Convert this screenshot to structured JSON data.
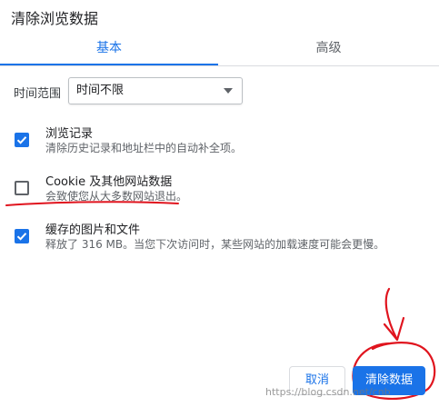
{
  "dialog": {
    "title": "清除浏览数据"
  },
  "tabs": [
    {
      "label": "基本",
      "active": true
    },
    {
      "label": "高级",
      "active": false
    }
  ],
  "time_range": {
    "label": "时间范围",
    "selected": "时间不限"
  },
  "items": [
    {
      "title": "浏览记录",
      "description": "清除历史记录和地址栏中的自动补全项。",
      "checked": true
    },
    {
      "title": "Cookie 及其他网站数据",
      "description": "会致使您从大多数网站退出。",
      "checked": false
    },
    {
      "title": "缓存的图片和文件",
      "description": "释放了 316 MB。当您下次访问时，某些网站的加载速度可能会更慢。",
      "checked": true
    }
  ],
  "buttons": {
    "cancel": "取消",
    "clear": "清除数据"
  },
  "watermark": "https://blog.csdn.net/cnb",
  "colors": {
    "accent": "#1a73e8",
    "annotation": "#e0141e"
  }
}
